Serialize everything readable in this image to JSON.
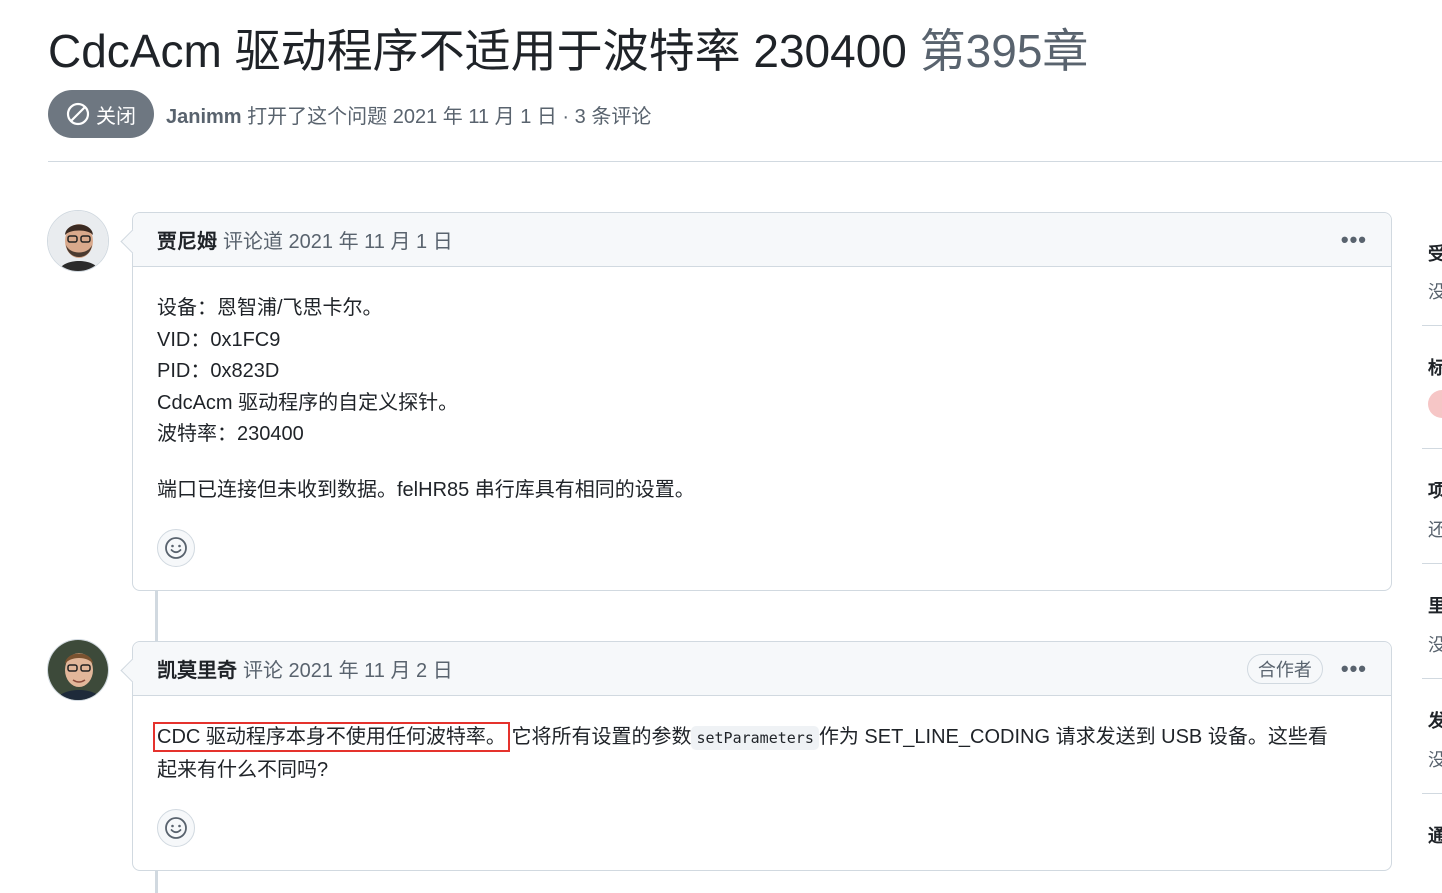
{
  "issue": {
    "title": "CdcAcm 驱动程序不适用于波特率 230400",
    "number": "第395章",
    "state_label": "关闭",
    "author": "Janimm",
    "opened_text": "打开了这个问题 2021 年 11 月 1 日 · 3 条评论"
  },
  "comments": [
    {
      "author": "贾尼姆",
      "action": "评论道 2021 年 11 月 1 日",
      "lines": [
        "设备：恩智浦/飞思卡尔。",
        "VID：0x1FC9",
        "PID：0x823D",
        "CdcAcm 驱动程序的自定义探针。",
        "波特率：230400"
      ],
      "paragraph2": "端口已连接但未收到数据。felHR85 串行库具有相同的设置。"
    },
    {
      "author": "凯莫里奇",
      "action": "评论 2021 年 11 月 2 日",
      "role": "合作者",
      "highlighted": "CDC 驱动程序本身不使用任何波特率。",
      "text_before_code": "它将所有设置的参数",
      "code": "setParameters",
      "text_after_code": "作为 SET_LINE_CODING 请求发送到 USB 设备。这些看",
      "line2": "起来有什么不同吗?"
    }
  ],
  "menu_label": "•••",
  "sidebar": {
    "items": [
      "受",
      "没",
      "标",
      "项",
      "还",
      "里",
      "没",
      "发",
      "没",
      "通"
    ]
  },
  "colors": {
    "closed_badge": "#6e7781",
    "highlight_box": "#e5322d",
    "border": "#d1d9e0"
  }
}
